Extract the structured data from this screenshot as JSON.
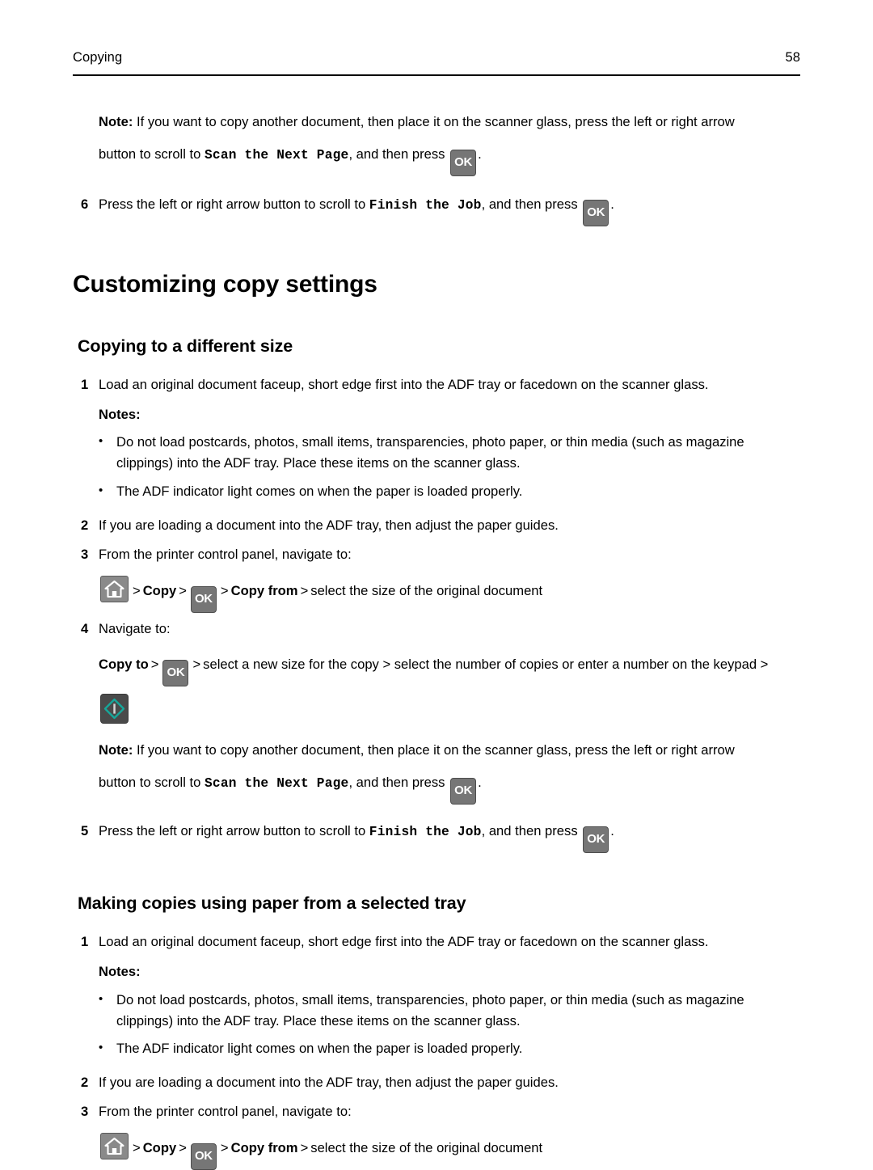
{
  "header": {
    "chapter": "Copying",
    "page_number": "58"
  },
  "icons": {
    "ok_key_label": "OK",
    "home_key": "home-icon",
    "start_key": "start-icon"
  },
  "colors": {
    "ok_key_fill": "#767676",
    "ok_key_border": "#4d4d4d",
    "home_key_fill": "#8a8a8a",
    "start_key_fill": "#4a4a4a",
    "start_diamond": "#16a79b",
    "text": "#000000"
  },
  "top_note": {
    "label": "Note:",
    "line1": " If you want to copy another document, then place it on the scanner glass, press the left or right arrow",
    "line2_pre": "button to scroll to ",
    "line2_mono": "Scan the Next Page",
    "line2_post": ", and then press ",
    "line2_end": "."
  },
  "step6": {
    "num": "6",
    "pre": "Press the left or right arrow button to scroll to ",
    "mono": "Finish the Job",
    "post": ", and then press ",
    "end": "."
  },
  "section_title": "Customizing copy settings",
  "subsection_1": {
    "title": "Copying to a different size",
    "steps": [
      {
        "num": "1",
        "text": "Load an original document faceup, short edge first into the ADF tray or facedown on the scanner glass."
      },
      {
        "num": "2",
        "text": "If you are loading a document into the ADF tray, then adjust the paper guides."
      },
      {
        "num": "3",
        "text": "From the printer control panel, navigate to:"
      },
      {
        "num": "4",
        "text": "Navigate to:"
      }
    ],
    "notes_label": "Notes:",
    "bullets": [
      "Do not load postcards, photos, small items, transparencies, photo paper, or thin media (such as magazine clippings) into the ADF tray. Place these items on the scanner glass.",
      "The ADF indicator light comes on when the paper is loaded properly."
    ],
    "navpath_copy_from": {
      "sep1": ">",
      "copy": "Copy",
      "sep2": ">",
      "sep3": ">",
      "copy_from": "Copy from",
      "sep4": ">",
      "tail": "select the size of the original document"
    },
    "navpath_copy_to": {
      "copy_to": "Copy to",
      "sep1": ">",
      "sep2": ">",
      "mid": "select a new size for the copy > select the number of copies or enter a number on the keypad >"
    },
    "note": {
      "label": "Note:",
      "line1": " If you want to copy another document, then place it on the scanner glass, press the left or right arrow",
      "line2_pre": "button to scroll to ",
      "line2_mono": "Scan the Next Page",
      "line2_post": ", and then press ",
      "line2_end": "."
    },
    "step5": {
      "num": "5",
      "pre": "Press the left or right arrow button to scroll to ",
      "mono": "Finish the Job",
      "post": ", and then press ",
      "end": "."
    }
  },
  "subsection_2": {
    "title": "Making copies using paper from a selected tray",
    "steps": [
      {
        "num": "1",
        "text": "Load an original document faceup, short edge first into the ADF tray or facedown on the scanner glass."
      },
      {
        "num": "2",
        "text": "If you are loading a document into the ADF tray, then adjust the paper guides."
      },
      {
        "num": "3",
        "text": "From the printer control panel, navigate to:"
      }
    ],
    "notes_label": "Notes:",
    "bullets": [
      "Do not load postcards, photos, small items, transparencies, photo paper, or thin media (such as magazine clippings) into the ADF tray. Place these items on the scanner glass.",
      "The ADF indicator light comes on when the paper is loaded properly."
    ],
    "navpath_copy_from": {
      "sep1": ">",
      "copy": "Copy",
      "sep2": ">",
      "sep3": ">",
      "copy_from": "Copy from",
      "sep4": ">",
      "tail": "select the size of the original document"
    }
  }
}
